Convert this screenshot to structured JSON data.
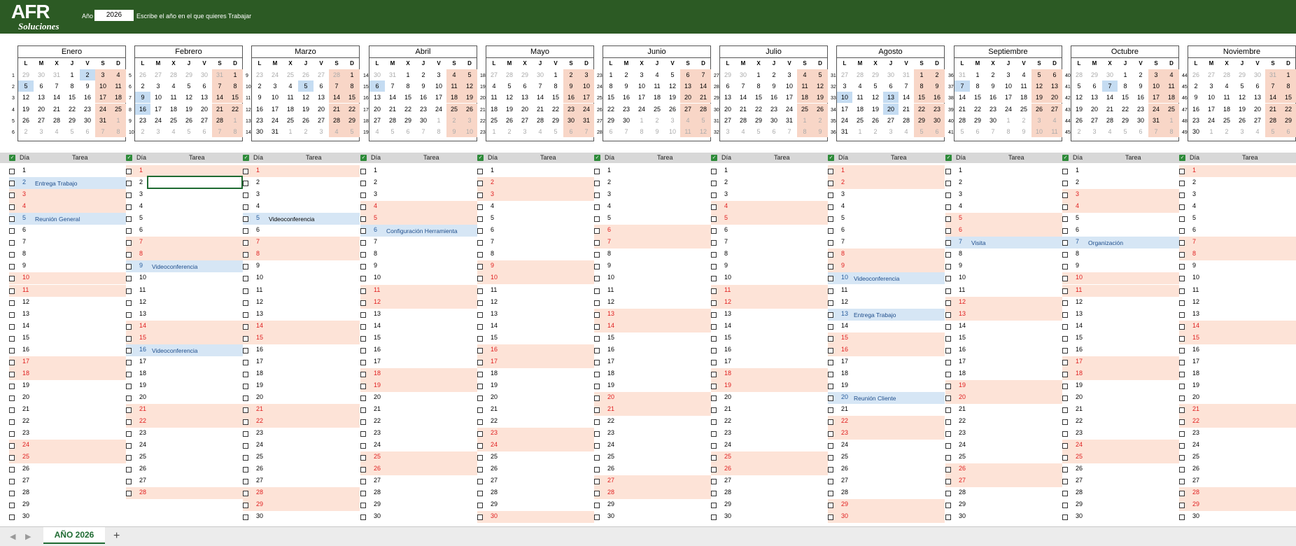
{
  "header": {
    "logo_main": "AFR",
    "logo_sub": "Soluciones",
    "year_label": "Año",
    "year_value": "2026",
    "hint": "Escribe el año en el que quieres Trabajar"
  },
  "weekday_headers": [
    "L",
    "M",
    "X",
    "J",
    "V",
    "S",
    "D"
  ],
  "grid_headers": {
    "day": "Día",
    "task": "Tarea"
  },
  "months": [
    {
      "name": "Enero",
      "weeks": [
        1,
        2,
        3,
        4,
        5,
        6
      ],
      "rows": [
        [
          "29",
          "30",
          "31",
          "1",
          "2",
          "3",
          "4"
        ],
        [
          "5",
          "6",
          "7",
          "8",
          "9",
          "10",
          "11"
        ],
        [
          "12",
          "13",
          "14",
          "15",
          "16",
          "17",
          "18"
        ],
        [
          "19",
          "20",
          "21",
          "22",
          "23",
          "24",
          "25"
        ],
        [
          "26",
          "27",
          "28",
          "29",
          "30",
          "31",
          "1"
        ],
        [
          "2",
          "3",
          "4",
          "5",
          "6",
          "7",
          "8"
        ]
      ],
      "first_cur": 3,
      "cur_len": 31,
      "hl": [
        4,
        7
      ],
      "days": 31,
      "weekends": [
        3,
        4,
        10,
        11,
        17,
        18,
        24,
        25,
        31
      ],
      "tasks": {
        "2": "Entrega Trabajo",
        "5": "Reunión General"
      }
    },
    {
      "name": "Febrero",
      "weeks": [
        5,
        6,
        7,
        8,
        9,
        10
      ],
      "rows": [
        [
          "26",
          "27",
          "28",
          "29",
          "30",
          "31",
          "1"
        ],
        [
          "2",
          "3",
          "4",
          "5",
          "6",
          "7",
          "8"
        ],
        [
          "9",
          "10",
          "11",
          "12",
          "13",
          "14",
          "15"
        ],
        [
          "16",
          "17",
          "18",
          "19",
          "20",
          "21",
          "22"
        ],
        [
          "23",
          "24",
          "25",
          "26",
          "27",
          "28",
          "1"
        ],
        [
          "2",
          "3",
          "4",
          "5",
          "6",
          "7",
          "8"
        ]
      ],
      "first_cur": 6,
      "cur_len": 28,
      "hl": [
        14,
        21
      ],
      "days": 28,
      "weekends": [
        1,
        7,
        8,
        14,
        15,
        21,
        22,
        28
      ],
      "tasks": {
        "9": "Videoconferencia",
        "16": "Videoconferencia"
      }
    },
    {
      "name": "Marzo",
      "weeks": [
        9,
        10,
        11,
        12,
        13,
        14
      ],
      "rows": [
        [
          "23",
          "24",
          "25",
          "26",
          "27",
          "28",
          "1"
        ],
        [
          "2",
          "3",
          "4",
          "5",
          "6",
          "7",
          "8"
        ],
        [
          "9",
          "10",
          "11",
          "12",
          "13",
          "14",
          "15"
        ],
        [
          "16",
          "17",
          "18",
          "19",
          "20",
          "21",
          "22"
        ],
        [
          "23",
          "24",
          "25",
          "26",
          "27",
          "28",
          "29"
        ],
        [
          "30",
          "31",
          "1",
          "2",
          "3",
          "4",
          "5"
        ]
      ],
      "first_cur": 6,
      "cur_len": 31,
      "hl": [
        10
      ],
      "days": 31,
      "weekends": [
        1,
        7,
        8,
        14,
        15,
        21,
        22,
        28,
        29
      ],
      "tasks": {
        "5": "Videoconferencia"
      }
    },
    {
      "name": "Abril",
      "weeks": [
        14,
        15,
        16,
        17,
        18,
        19
      ],
      "rows": [
        [
          "30",
          "31",
          "1",
          "2",
          "3",
          "4",
          "5"
        ],
        [
          "6",
          "7",
          "8",
          "9",
          "10",
          "11",
          "12"
        ],
        [
          "13",
          "14",
          "15",
          "16",
          "17",
          "18",
          "19"
        ],
        [
          "20",
          "21",
          "22",
          "23",
          "24",
          "25",
          "26"
        ],
        [
          "27",
          "28",
          "29",
          "30",
          "1",
          "2",
          "3"
        ],
        [
          "4",
          "5",
          "6",
          "7",
          "8",
          "9",
          "10"
        ]
      ],
      "first_cur": 2,
      "cur_len": 30,
      "hl": [
        7
      ],
      "days": 30,
      "weekends": [
        4,
        5,
        11,
        12,
        18,
        19,
        25,
        26
      ],
      "tasks": {
        "6": "Configuración Herramienta"
      }
    },
    {
      "name": "Mayo",
      "weeks": [
        18,
        19,
        20,
        21,
        22,
        23
      ],
      "rows": [
        [
          "27",
          "28",
          "29",
          "30",
          "1",
          "2",
          "3"
        ],
        [
          "4",
          "5",
          "6",
          "7",
          "8",
          "9",
          "10"
        ],
        [
          "11",
          "12",
          "13",
          "14",
          "15",
          "16",
          "17"
        ],
        [
          "18",
          "19",
          "20",
          "21",
          "22",
          "23",
          "24"
        ],
        [
          "25",
          "26",
          "27",
          "28",
          "29",
          "30",
          "31"
        ],
        [
          "1",
          "2",
          "3",
          "4",
          "5",
          "6",
          "7"
        ]
      ],
      "first_cur": 4,
      "cur_len": 31,
      "hl": [],
      "days": 31,
      "weekends": [
        2,
        3,
        9,
        10,
        16,
        17,
        23,
        24,
        30,
        31
      ],
      "tasks": {}
    },
    {
      "name": "Junio",
      "weeks": [
        23,
        24,
        25,
        26,
        27,
        28
      ],
      "rows": [
        [
          "1",
          "2",
          "3",
          "4",
          "5",
          "6",
          "7"
        ],
        [
          "8",
          "9",
          "10",
          "11",
          "12",
          "13",
          "14"
        ],
        [
          "15",
          "16",
          "17",
          "18",
          "19",
          "20",
          "21"
        ],
        [
          "22",
          "23",
          "24",
          "25",
          "26",
          "27",
          "28"
        ],
        [
          "29",
          "30",
          "1",
          "2",
          "3",
          "4",
          "5"
        ],
        [
          "6",
          "7",
          "8",
          "9",
          "10",
          "11",
          "12"
        ]
      ],
      "first_cur": 0,
      "cur_len": 30,
      "hl": [],
      "days": 30,
      "weekends": [
        6,
        7,
        13,
        14,
        20,
        21,
        27,
        28
      ],
      "tasks": {}
    },
    {
      "name": "Julio",
      "weeks": [
        27,
        28,
        29,
        30,
        31,
        32
      ],
      "rows": [
        [
          "29",
          "30",
          "1",
          "2",
          "3",
          "4",
          "5"
        ],
        [
          "6",
          "7",
          "8",
          "9",
          "10",
          "11",
          "12"
        ],
        [
          "13",
          "14",
          "15",
          "16",
          "17",
          "18",
          "19"
        ],
        [
          "20",
          "21",
          "22",
          "23",
          "24",
          "25",
          "26"
        ],
        [
          "27",
          "28",
          "29",
          "30",
          "31",
          "1",
          "2"
        ],
        [
          "3",
          "4",
          "5",
          "6",
          "7",
          "8",
          "9"
        ]
      ],
      "first_cur": 2,
      "cur_len": 31,
      "hl": [],
      "days": 31,
      "weekends": [
        4,
        5,
        11,
        12,
        18,
        19,
        25,
        26
      ],
      "tasks": {}
    },
    {
      "name": "Agosto",
      "weeks": [
        31,
        32,
        33,
        34,
        35,
        36
      ],
      "rows": [
        [
          "27",
          "28",
          "29",
          "30",
          "31",
          "1",
          "2"
        ],
        [
          "3",
          "4",
          "5",
          "6",
          "7",
          "8",
          "9"
        ],
        [
          "10",
          "11",
          "12",
          "13",
          "14",
          "15",
          "16"
        ],
        [
          "17",
          "18",
          "19",
          "20",
          "21",
          "22",
          "23"
        ],
        [
          "24",
          "25",
          "26",
          "27",
          "28",
          "29",
          "30"
        ],
        [
          "31",
          "1",
          "2",
          "3",
          "4",
          "5",
          "6"
        ]
      ],
      "first_cur": 5,
      "cur_len": 31,
      "hl": [
        14,
        17,
        24
      ],
      "days": 31,
      "weekends": [
        1,
        2,
        8,
        9,
        15,
        16,
        22,
        23,
        29,
        30
      ],
      "tasks": {
        "10": "Videoconferencia",
        "13": "Entrega Trabajo",
        "20": "Reunión Cliente"
      }
    },
    {
      "name": "Septiembre",
      "weeks": [
        36,
        37,
        38,
        39,
        40,
        41
      ],
      "rows": [
        [
          "31",
          "1",
          "2",
          "3",
          "4",
          "5",
          "6"
        ],
        [
          "7",
          "8",
          "9",
          "10",
          "11",
          "12",
          "13"
        ],
        [
          "14",
          "15",
          "16",
          "17",
          "18",
          "19",
          "20"
        ],
        [
          "21",
          "22",
          "23",
          "24",
          "25",
          "26",
          "27"
        ],
        [
          "28",
          "29",
          "30",
          "1",
          "2",
          "3",
          "4"
        ],
        [
          "5",
          "6",
          "7",
          "8",
          "9",
          "10",
          "11"
        ]
      ],
      "first_cur": 1,
      "cur_len": 30,
      "hl": [
        7
      ],
      "days": 30,
      "weekends": [
        5,
        6,
        12,
        13,
        19,
        20,
        26,
        27
      ],
      "tasks": {
        "7": "Visita"
      }
    },
    {
      "name": "Octubre",
      "weeks": [
        40,
        41,
        42,
        43,
        44,
        45
      ],
      "rows": [
        [
          "28",
          "29",
          "30",
          "1",
          "2",
          "3",
          "4"
        ],
        [
          "5",
          "6",
          "7",
          "8",
          "9",
          "10",
          "11"
        ],
        [
          "12",
          "13",
          "14",
          "15",
          "16",
          "17",
          "18"
        ],
        [
          "19",
          "20",
          "21",
          "22",
          "23",
          "24",
          "25"
        ],
        [
          "26",
          "27",
          "28",
          "29",
          "30",
          "31",
          "1"
        ],
        [
          "2",
          "3",
          "4",
          "5",
          "6",
          "7",
          "8"
        ]
      ],
      "first_cur": 3,
      "cur_len": 31,
      "hl": [
        9
      ],
      "days": 31,
      "weekends": [
        3,
        4,
        10,
        11,
        17,
        18,
        24,
        25,
        31
      ],
      "tasks": {
        "7": "Organización"
      }
    },
    {
      "name": "Noviembre",
      "weeks": [
        44,
        45,
        46,
        47,
        48,
        49
      ],
      "rows": [
        [
          "26",
          "27",
          "28",
          "29",
          "30",
          "31",
          "1"
        ],
        [
          "2",
          "3",
          "4",
          "5",
          "6",
          "7",
          "8"
        ],
        [
          "9",
          "10",
          "11",
          "12",
          "13",
          "14",
          "15"
        ],
        [
          "16",
          "17",
          "18",
          "19",
          "20",
          "21",
          "22"
        ],
        [
          "23",
          "24",
          "25",
          "26",
          "27",
          "28",
          "29"
        ],
        [
          "30",
          "1",
          "2",
          "3",
          "4",
          "5",
          "6"
        ]
      ],
      "first_cur": 6,
      "cur_len": 30,
      "hl": [],
      "days": 30,
      "weekends": [
        1,
        7,
        8,
        14,
        15,
        21,
        22,
        28,
        29
      ],
      "tasks": {}
    }
  ],
  "sheet_tab": "AÑO 2026",
  "tab_add": "+",
  "tab_prev": "◀",
  "tab_next": "▶"
}
